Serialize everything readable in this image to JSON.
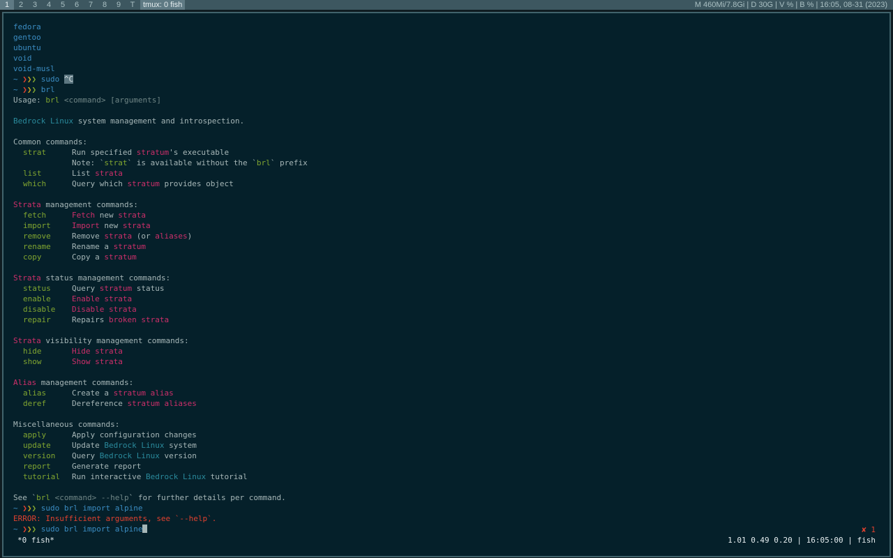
{
  "topbar": {
    "workspaces": [
      "1",
      "2",
      "3",
      "4",
      "5",
      "6",
      "7",
      "8",
      "9",
      "T"
    ],
    "active_workspace": "1",
    "window_title": "tmux: 0 fish",
    "status": "M 460Mi/7.8Gi | D 30G | V % | B % | 16:05, 08-31 (2023)"
  },
  "terminal": {
    "prompt_tilde": "~",
    "prompt_arrows": "❯❯❯",
    "distros": [
      "fedora",
      "gentoo",
      "ubuntu",
      "void",
      "void-musl"
    ],
    "cmd_sudo": "sudo",
    "cmd_sudo_ctrl": "^C",
    "cmd_brl": "brl",
    "usage": {
      "label": "Usage:",
      "cmd": "brl",
      "args": "<command> [arguments]"
    },
    "description": {
      "brand": "Bedrock Linux",
      "rest": " system management and introspection."
    },
    "sections": {
      "common": {
        "header": "Common commands:",
        "items": [
          {
            "cmd": "strat",
            "pre": "Run specified ",
            "kw": "stratum",
            "post": "'s executable"
          },
          {
            "note": "Note: `strat` is available without the `brl` prefix"
          },
          {
            "cmd": "list",
            "pre": "List ",
            "kw": "strata",
            "post": ""
          },
          {
            "cmd": "which",
            "pre": "Query which ",
            "kw": "stratum",
            "post": " provides object"
          }
        ]
      },
      "strata_mgmt": {
        "header_kw": "Strata",
        "header_rest": " management commands:",
        "items": [
          {
            "cmd": "fetch",
            "kw1": "Fetch",
            "mid": " new ",
            "kw2": "strata",
            "post": ""
          },
          {
            "cmd": "import",
            "kw1": "Import",
            "mid": " new ",
            "kw2": "strata",
            "post": ""
          },
          {
            "cmd": "remove",
            "pre": "Remove ",
            "kw": "strata",
            "mid": " (or ",
            "kw2": "aliases",
            "post": ")"
          },
          {
            "cmd": "rename",
            "pre": "Rename a ",
            "kw": "stratum"
          },
          {
            "cmd": "copy",
            "pre": "Copy a ",
            "kw": "stratum"
          }
        ]
      },
      "strata_status": {
        "header_kw": "Strata",
        "header_rest": " status management commands:",
        "items": [
          {
            "cmd": "status",
            "pre": "Query ",
            "kw": "stratum",
            "post": " status"
          },
          {
            "cmd": "enable",
            "kw1": "Enable",
            "kw2": "strata"
          },
          {
            "cmd": "disable",
            "kw1": "Disable",
            "kw2": "strata"
          },
          {
            "cmd": "repair",
            "pre": "Repairs ",
            "kw": "broken strata"
          }
        ]
      },
      "strata_visibility": {
        "header_kw": "Strata",
        "header_rest": " visibility management commands:",
        "items": [
          {
            "cmd": "hide",
            "kw1": "Hide",
            "kw2": "strata"
          },
          {
            "cmd": "show",
            "kw1": "Show",
            "kw2": "strata"
          }
        ]
      },
      "alias": {
        "header_kw": "Alias",
        "header_rest": " management commands:",
        "items": [
          {
            "cmd": "alias",
            "pre": "Create a ",
            "kw": "stratum alias"
          },
          {
            "cmd": "deref",
            "pre": "Dereference ",
            "kw": "stratum aliases"
          }
        ]
      },
      "misc": {
        "header": "Miscellaneous commands:",
        "items": [
          {
            "cmd": "apply",
            "pre": "Apply configuration changes"
          },
          {
            "cmd": "update",
            "pre": "Update ",
            "brand": "Bedrock Linux",
            "post": " system"
          },
          {
            "cmd": "version",
            "pre": "Query ",
            "brand": "Bedrock Linux",
            "post": " version"
          },
          {
            "cmd": "report",
            "pre": "Generate report"
          },
          {
            "cmd": "tutorial",
            "pre": "Run interactive ",
            "brand": "Bedrock Linux",
            "post": " tutorial"
          }
        ]
      }
    },
    "see_help": {
      "pre": "See `",
      "cmd": "brl",
      "args": " <command> --help",
      "post": "` for further details per command."
    },
    "cmd_import": "sudo brl import alpine",
    "error": {
      "label": "ERROR:",
      "msg": " Insufficient arguments, see `--help`."
    },
    "current_input": "sudo brl import alpine",
    "error_marker": "✘ 1"
  },
  "tmux": {
    "left": "*0 fish*",
    "right": "1.01 0.49 0.20 | 16:05:00 | fish"
  }
}
